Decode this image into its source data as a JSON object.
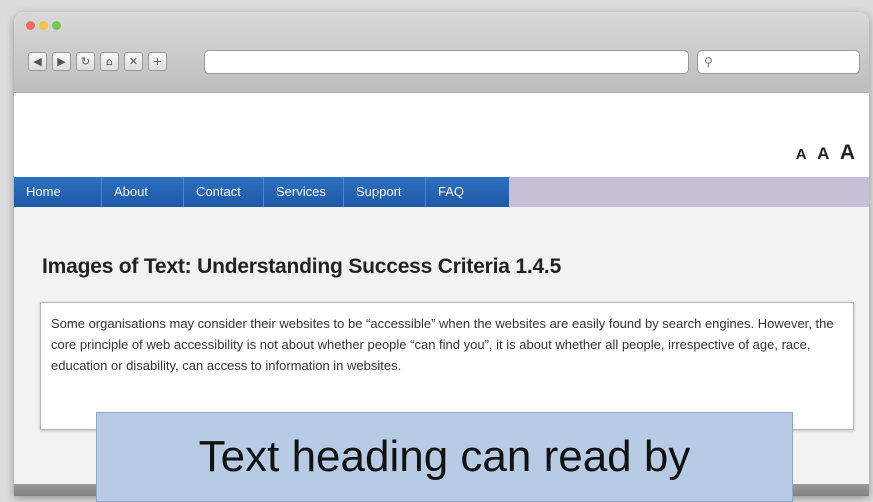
{
  "browser": {
    "icons": [
      "back-icon",
      "forward-icon",
      "reload-icon",
      "home-icon",
      "close-icon",
      "new-tab-icon"
    ],
    "search_icon": "search-icon"
  },
  "font_size_controls": [
    "A",
    "A",
    "A"
  ],
  "menu": {
    "items": [
      "Home",
      "About",
      "Contact",
      "Services",
      "Support",
      "FAQ"
    ]
  },
  "page": {
    "title": "Images of Text: Understanding Success Criteria 1.4.5",
    "body": "Some organisations may consider their websites to be “accessible” when the websites are easily found by search engines. However, the core principle of web accessibility is not about whether people “can find you”, it is about whether all people, irrespective of age, race, education or disability, can access to information in websites."
  },
  "caption": "Text heading can read by",
  "colors": {
    "menu_blue": "#1d58a6",
    "menu_filler": "#c7bfd8",
    "caption_bg": "#b8cbe4"
  }
}
